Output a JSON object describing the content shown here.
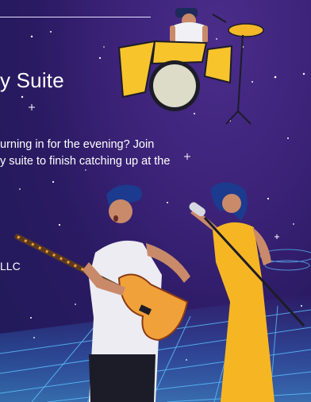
{
  "slide": {
    "title": "y Suite",
    "body_line1": "urning in for the evening?  Join",
    "body_line2": "y suite to finish catching up at the",
    "company": "LLC"
  },
  "colors": {
    "background": "#2f1e6c",
    "neon_grid": "#3fa8ff",
    "dress": "#f6b623",
    "drum_yellow": "#f7c42c",
    "guitar": "#f0a13a"
  }
}
